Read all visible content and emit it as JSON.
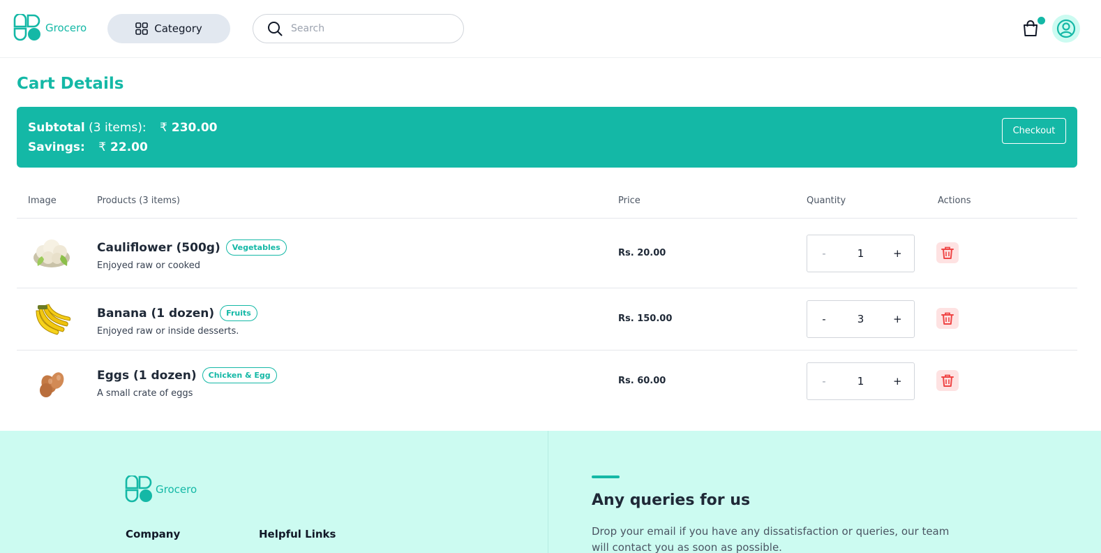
{
  "header": {
    "brand": "Grocero",
    "category_label": "Category",
    "search_placeholder": "Search",
    "cart_has_items": true
  },
  "page_title": "Cart Details",
  "summary": {
    "subtotal_label": "Subtotal",
    "items_count": "(3 items):",
    "subtotal_amount": "230.00",
    "savings_label": "Savings:",
    "savings_amount": "22.00",
    "currency_symbol": "₹",
    "checkout_label": "Checkout"
  },
  "table": {
    "headers": {
      "image": "Image",
      "products": "Products (3 items)",
      "price": "Price",
      "quantity": "Quantity",
      "actions": "Actions"
    },
    "rows": [
      {
        "name": "Cauliflower (500g)",
        "tag": "Vegetables",
        "desc": "Enjoyed raw or cooked",
        "price": "Rs. 20.00",
        "qty": "1",
        "minus": "-",
        "plus": "+",
        "image": "cauliflower-image"
      },
      {
        "name": "Banana (1 dozen)",
        "tag": "Fruits",
        "desc": "Enjoyed raw or inside desserts.",
        "price": "Rs. 150.00",
        "qty": "3",
        "minus": "-",
        "plus": "+",
        "image": "banana-image"
      },
      {
        "name": "Eggs (1 dozen)",
        "tag": "Chicken & Egg",
        "desc": "A small crate of eggs",
        "price": "Rs. 60.00",
        "qty": "1",
        "minus": "-",
        "plus": "+",
        "image": "eggs-image"
      }
    ]
  },
  "footer": {
    "brand": "Grocero",
    "company_heading": "Company",
    "links_heading": "Helpful Links",
    "queries_heading": "Any queries for us",
    "queries_text": "Drop your email if you have any dissatisfaction or queries, our team will contact you as soon as possible."
  },
  "colors": {
    "accent": "#14b8a6",
    "accent_light": "#ccfbf1",
    "danger": "#ef4444",
    "danger_bg": "#fee2e2"
  }
}
